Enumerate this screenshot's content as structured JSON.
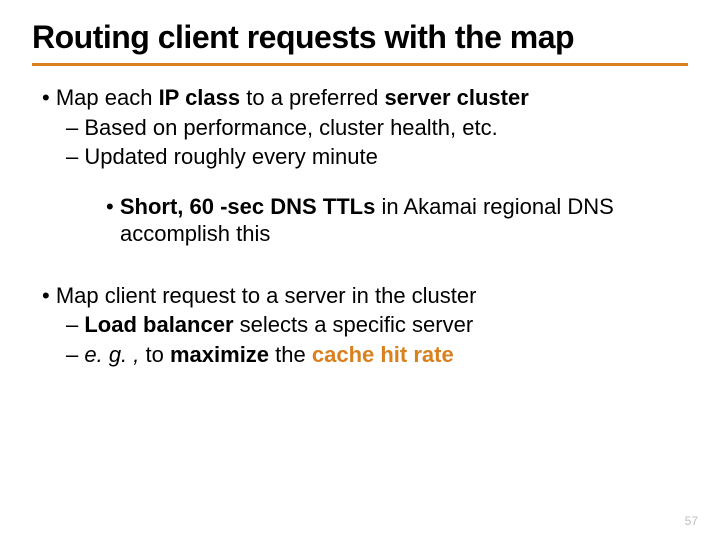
{
  "title": "Routing client requests with the map",
  "b1": {
    "line": {
      "pre": "Map each ",
      "bold1": "IP class",
      "mid": " to a preferred ",
      "bold2": "server cluster"
    },
    "s1": "Based on performance, cluster health, etc.",
    "s2": "Updated roughly every minute",
    "sub": {
      "bold": "Short, 60 -sec DNS TTLs",
      "rest": " in Akamai regional DNS accomplish this"
    }
  },
  "b2": {
    "line": "Map client request to a server in the cluster",
    "s1": {
      "bold": "Load balancer",
      "rest": " selects a specific server"
    },
    "s2": {
      "em": "e. g. ,",
      "mid": " to ",
      "bold": "maximize",
      "mid2": " the ",
      "hit": "cache hit rate"
    }
  },
  "page": "57"
}
